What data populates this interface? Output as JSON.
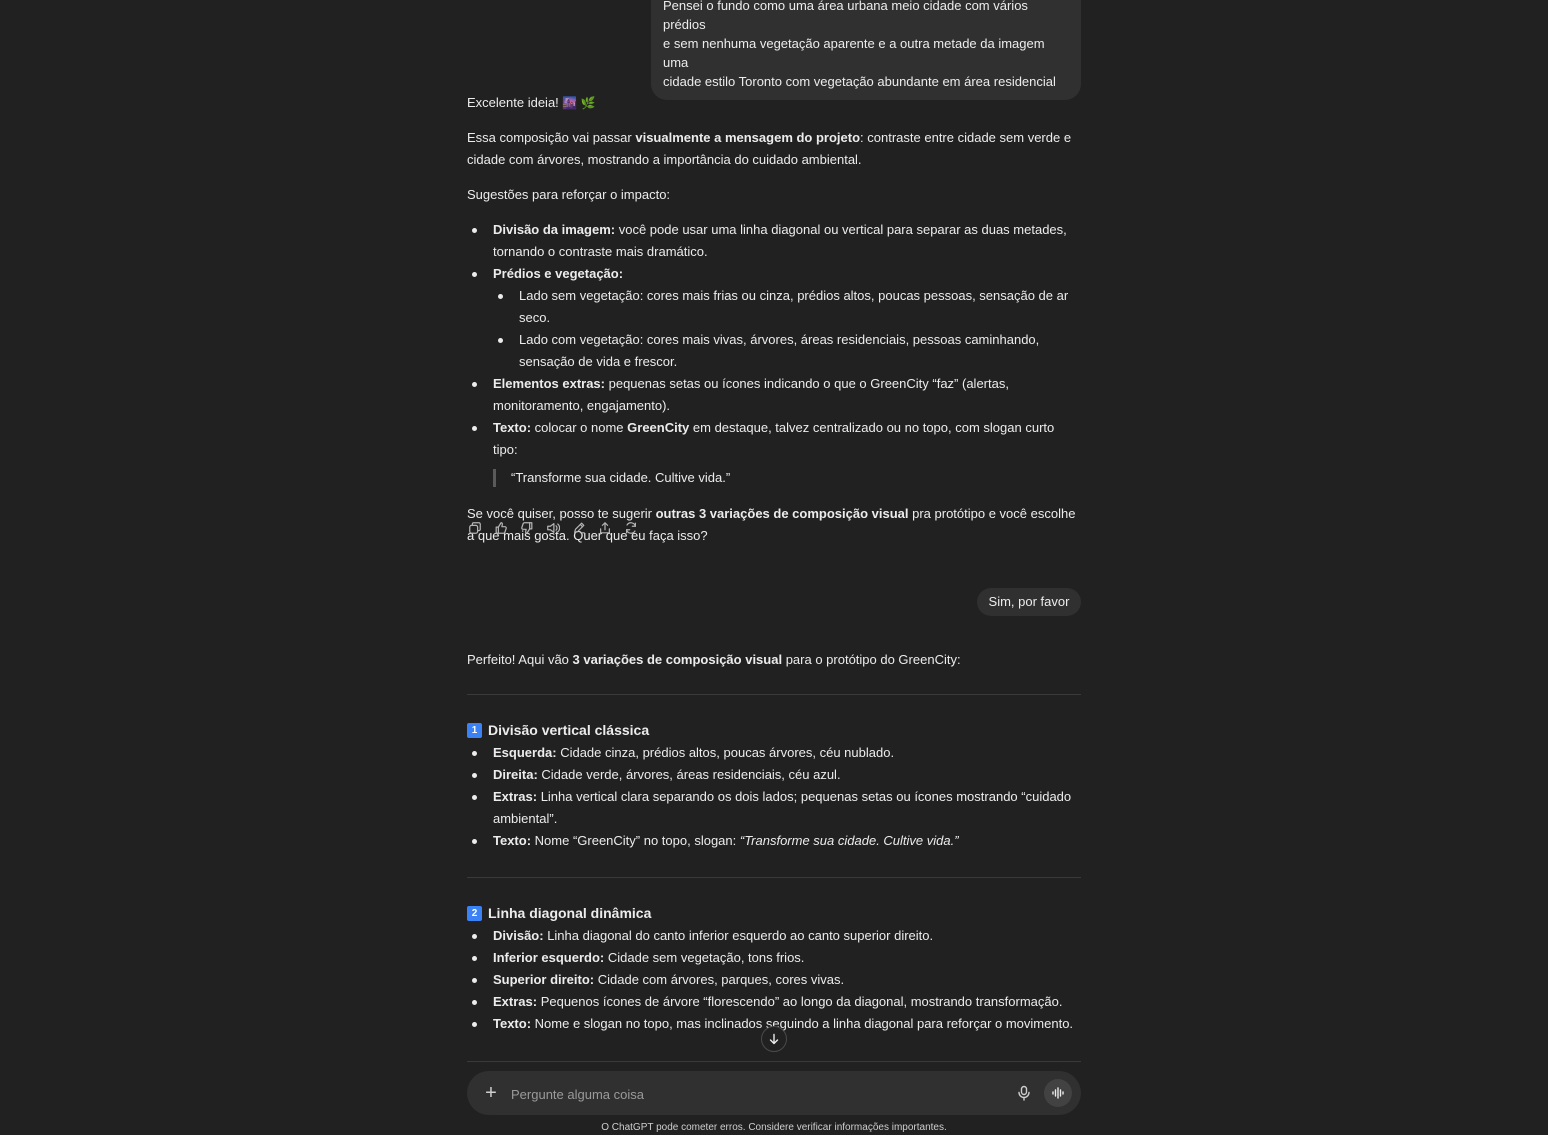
{
  "user_msg1": {
    "line1": "Pensei o fundo como uma área urbana meio cidade com vários prédios",
    "line2": "e sem nenhuma vegetação aparente e a outra metade da imagem uma",
    "line3": "cidade estilo Toronto com vegetação abundante em área residencial"
  },
  "reply1": {
    "greeting": "Excelente ideia!",
    "greeting_emojis": "🌆 🌿",
    "p1_pre": "Essa composição vai passar ",
    "p1_bold": "visualmente a mensagem do projeto",
    "p1_post": ": contraste entre cidade sem verde e cidade com árvores, mostrando a importância do cuidado ambiental.",
    "p2": "Sugestões para reforçar o impacto:",
    "b1_bold": "Divisão da imagem:",
    "b1_text": " você pode usar uma linha diagonal ou vertical para separar as duas metades, tornando o contraste mais dramático.",
    "b2_bold": "Prédios e vegetação:",
    "b2_sub1": "Lado sem vegetação: cores mais frias ou cinza, prédios altos, poucas pessoas, sensação de ar seco.",
    "b2_sub2": "Lado com vegetação: cores mais vivas, árvores, áreas residenciais, pessoas caminhando, sensação de vida e frescor.",
    "b3_bold": "Elementos extras:",
    "b3_text": " pequenas setas ou ícones indicando o que o GreenCity “faz” (alertas, monitoramento, engajamento).",
    "b4_bold": "Texto:",
    "b4_pre": " colocar o nome ",
    "b4_name": "GreenCity",
    "b4_post": " em destaque, talvez centralizado ou no topo, com slogan curto tipo:",
    "quote": "“Transforme sua cidade. Cultive vida.”",
    "p3_pre": "Se você quiser, posso te sugerir ",
    "p3_bold": "outras 3 variações de composição visual",
    "p3_post": " pra protótipo e você escolhe a que mais gosta. Quer que eu faça isso?"
  },
  "action_icons": [
    "copy-icon",
    "thumbs-up-icon",
    "thumbs-down-icon",
    "speaker-icon",
    "edit-icon",
    "share-icon",
    "regenerate-icon"
  ],
  "user_msg2": "Sim, por favor",
  "reply2": {
    "intro_pre": "Perfeito! Aqui vão ",
    "intro_bold": "3 variações de composição visual",
    "intro_post": " para o protótipo do GreenCity:",
    "s1_num": "1",
    "s1_title": "Divisão vertical clássica",
    "s1_b1_bold": "Esquerda:",
    "s1_b1_text": " Cidade cinza, prédios altos, poucas árvores, céu nublado.",
    "s1_b2_bold": "Direita:",
    "s1_b2_text": " Cidade verde, árvores, áreas residenciais, céu azul.",
    "s1_b3_bold": "Extras:",
    "s1_b3_text": " Linha vertical clara separando os dois lados; pequenas setas ou ícones mostrando “cuidado ambiental”.",
    "s1_b4_bold": "Texto:",
    "s1_b4_text": " Nome “GreenCity” no topo, slogan: ",
    "s1_b4_italic": "“Transforme sua cidade. Cultive vida.”",
    "s2_num": "2",
    "s2_title": "Linha diagonal dinâmica",
    "s2_b1_bold": "Divisão:",
    "s2_b1_text": " Linha diagonal do canto inferior esquerdo ao canto superior direito.",
    "s2_b2_bold": "Inferior esquerdo:",
    "s2_b2_text": " Cidade sem vegetação, tons frios.",
    "s2_b3_bold": "Superior direito:",
    "s2_b3_text": " Cidade com árvores, parques, cores vivas.",
    "s2_b4_bold": "Extras:",
    "s2_b4_text": " Pequenos ícones de árvore “florescendo” ao longo da diagonal, mostrando transformação.",
    "s2_b5_bold": "Texto:",
    "s2_b5_text": " Nome e slogan no topo, mas inclinados seguindo a linha diagonal para reforçar o movimento."
  },
  "composer": {
    "plus": "+",
    "placeholder": "Pergunte alguma coisa"
  },
  "disclaimer": "O ChatGPT pode cometer erros. Considere verificar informações importantes."
}
